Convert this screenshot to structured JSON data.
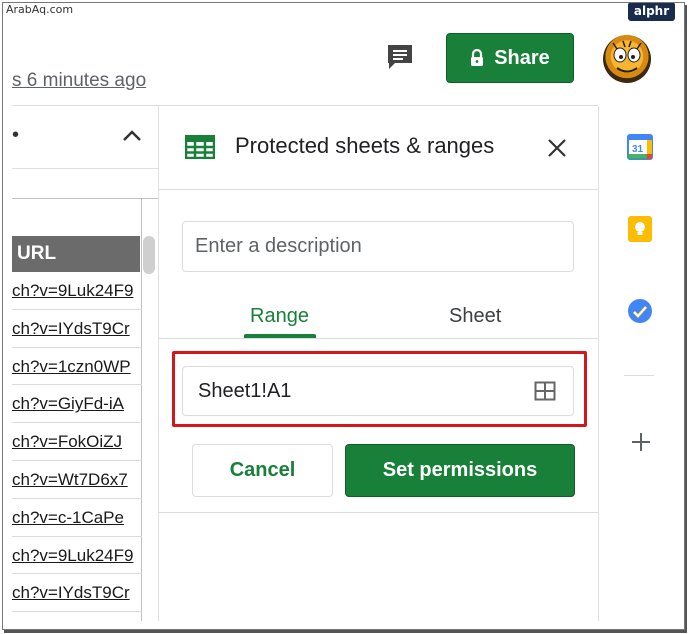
{
  "watermark": "ArabAq.com",
  "badge": "alphr",
  "header": {
    "last_edit": "s 6 minutes ago",
    "share_label": "Share",
    "comment_icon": "comment-icon",
    "avatar_icon": "avatar"
  },
  "sheet": {
    "dot": "•",
    "column_header": "URL",
    "cells": [
      "ch?v=9Luk24F9",
      "ch?v=IYdsT9Cr",
      "ch?v=1czn0WP",
      "ch?v=GiyFd-iA",
      "ch?v=FokOiZJ",
      "ch?v=Wt7D6x7",
      "ch?v=c-1CaPe",
      "ch?v=9Luk24F9",
      "ch?v=IYdsT9Cr"
    ]
  },
  "panel": {
    "title": "Protected sheets & ranges",
    "description_placeholder": "Enter a description",
    "tabs": [
      {
        "label": "Range",
        "active": true
      },
      {
        "label": "Sheet",
        "active": false
      }
    ],
    "range_value": "Sheet1!A1",
    "cancel_label": "Cancel",
    "set_permissions_label": "Set permissions"
  },
  "side_panel": {
    "calendar_label": "31",
    "icons": [
      "calendar-icon",
      "keep-icon",
      "tasks-icon",
      "add-icon"
    ]
  },
  "colors": {
    "accent": "#188038",
    "highlight": "#d4171d"
  }
}
